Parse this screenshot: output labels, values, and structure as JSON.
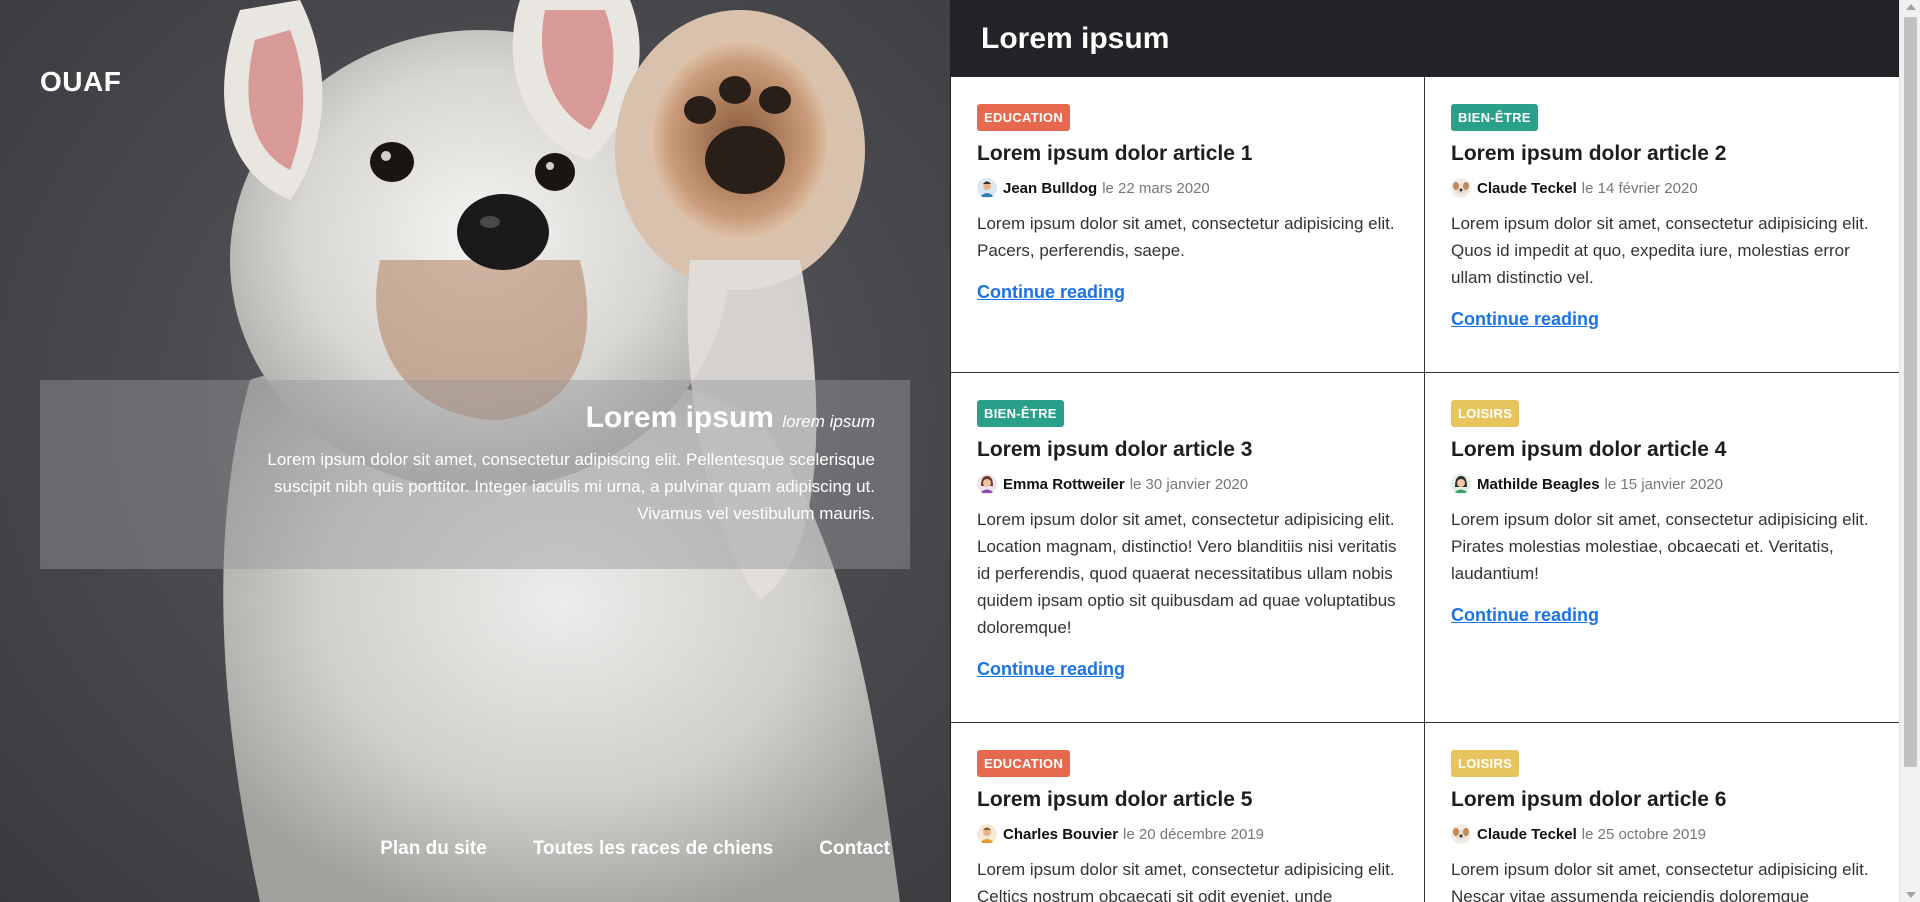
{
  "hero": {
    "logo": "OUAF",
    "intro_title": "Lorem ipsum",
    "intro_subtitle": "lorem ipsum",
    "intro_text": "Lorem ipsum dolor sit amet, consectetur adipiscing elit. Pellentesque scelerisque suscipit nibh quis porttitor. Integer iaculis mi urna, a pulvinar quam adipiscing ut. Vivamus vel vestibulum mauris.",
    "nav": [
      "Plan du site",
      "Toutes les races de chiens",
      "Contact"
    ]
  },
  "panel": {
    "title": "Lorem ipsum",
    "continue_label": "Continue reading",
    "articles": [
      {
        "tag": "EDUCATION",
        "tag_color": "#e5684f",
        "title": "Lorem ipsum dolor article 1",
        "author": "Jean Bulldog",
        "date": "le 22 mars 2020",
        "avatar_icon": "man-avatar-icon",
        "excerpt": "Lorem ipsum dolor sit amet, consectetur adipisicing elit. Pacers, perferendis, saepe."
      },
      {
        "tag": "BIEN-ÊTRE",
        "tag_color": "#29a18a",
        "title": "Lorem ipsum dolor article 2",
        "author": "Claude Teckel",
        "date": "le 14 février 2020",
        "avatar_icon": "dog-avatar-icon",
        "excerpt": "Lorem ipsum dolor sit amet, consectetur adipisicing elit. Quos id impedit at quo, expedita iure, molestias error ullam distinctio vel."
      },
      {
        "tag": "BIEN-ÊTRE",
        "tag_color": "#29a18a",
        "title": "Lorem ipsum dolor article 3",
        "author": "Emma Rottweiler",
        "date": "le 30 janvier 2020",
        "avatar_icon": "woman-avatar-icon",
        "excerpt": "Lorem ipsum dolor sit amet, consectetur adipisicing elit. Location magnam, distinctio! Vero blanditiis nisi veritatis id perferendis, quod quaerat necessitatibus ullam nobis quidem ipsam optio sit quibusdam ad quae voluptatibus doloremque!"
      },
      {
        "tag": "LOISIRS",
        "tag_color": "#e8c45f",
        "title": "Lorem ipsum dolor article 4",
        "author": "Mathilde Beagles",
        "date": "le 15 janvier 2020",
        "avatar_icon": "woman-green-avatar-icon",
        "excerpt": "Lorem ipsum dolor sit amet, consectetur adipisicing elit. Pirates molestias molestiae, obcaecati et. Veritatis, laudantium!"
      },
      {
        "tag": "EDUCATION",
        "tag_color": "#e5684f",
        "title": "Lorem ipsum dolor article 5",
        "author": "Charles Bouvier",
        "date": "le 20 décembre 2019",
        "avatar_icon": "man-orange-avatar-icon",
        "excerpt": "Lorem ipsum dolor sit amet, consectetur adipisicing elit. Celtics nostrum obcaecati sit odit eveniet, unde"
      },
      {
        "tag": "LOISIRS",
        "tag_color": "#e8c45f",
        "title": "Lorem ipsum dolor article 6",
        "author": "Claude Teckel",
        "date": "le 25 octobre 2019",
        "avatar_icon": "dog-avatar-icon",
        "excerpt": "Lorem ipsum dolor sit amet, consectetur adipisicing elit. Nescar vitae assumenda reiciendis doloremque"
      }
    ]
  }
}
